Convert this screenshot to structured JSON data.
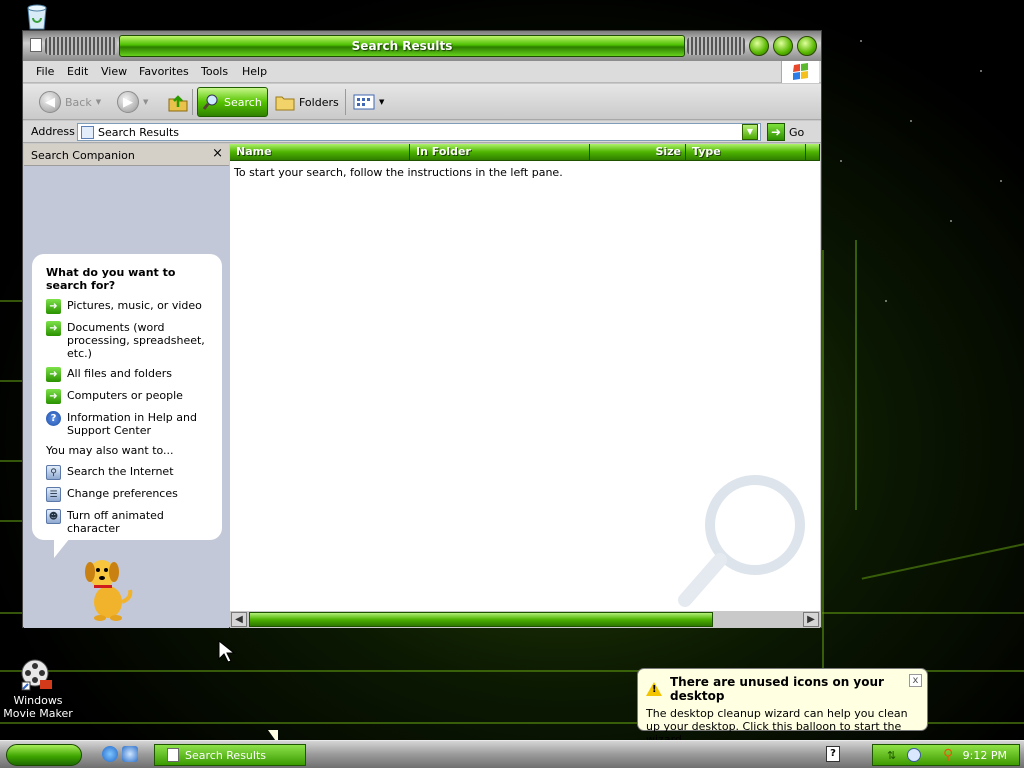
{
  "window": {
    "title": "Search Results"
  },
  "menu": [
    "File",
    "Edit",
    "View",
    "Favorites",
    "Tools",
    "Help"
  ],
  "toolbar": {
    "back": "Back",
    "search": "Search",
    "folders": "Folders"
  },
  "address": {
    "label": "Address",
    "value": "Search Results",
    "go": "Go"
  },
  "left_pane": {
    "title": "Search Companion",
    "close": "×",
    "question": "What do you want to search for?",
    "options": [
      {
        "label": "Pictures, music, or video",
        "icon": "green-arrow-icon"
      },
      {
        "label": "Documents (word processing, spreadsheet, etc.)",
        "icon": "green-arrow-icon"
      },
      {
        "label": "All files and folders",
        "icon": "green-arrow-icon"
      },
      {
        "label": "Computers or people",
        "icon": "green-arrow-icon"
      },
      {
        "label": "Information in Help and Support Center",
        "icon": "help-icon"
      }
    ],
    "also_label": "You may also want to...",
    "also": [
      {
        "label": "Search the Internet",
        "icon": "internet-search-icon"
      },
      {
        "label": "Change preferences",
        "icon": "preferences-icon"
      },
      {
        "label": "Turn off animated character",
        "icon": "character-icon"
      }
    ]
  },
  "columns": [
    "Name",
    "In Folder",
    "Size",
    "Type"
  ],
  "results": {
    "instructions": "To start your search, follow the instructions in the left pane."
  },
  "desktop_icons": [
    {
      "label": "Windows Movie Maker"
    }
  ],
  "notification": {
    "title": "There are unused icons on your desktop",
    "text": "The desktop cleanup wizard can help you clean up your desktop. Click this balloon to start the wizard.",
    "close": "x"
  },
  "taskbar": {
    "task": "Search Results",
    "clock": "9:12 PM"
  },
  "colors": {
    "accent": "#4cbf00",
    "window_bg": "#c8c8c8",
    "balloon_bg": "#ffffe1"
  }
}
